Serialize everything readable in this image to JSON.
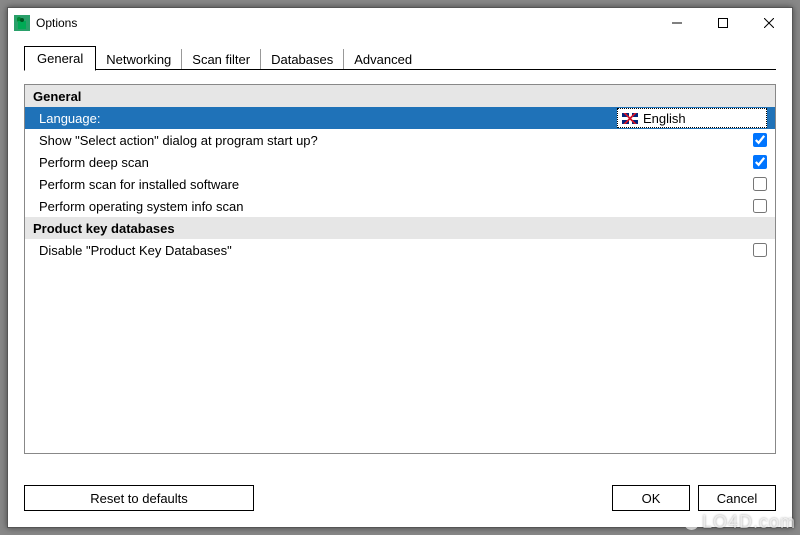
{
  "window": {
    "title": "Options"
  },
  "tabs": [
    {
      "label": "General",
      "active": true
    },
    {
      "label": "Networking",
      "active": false
    },
    {
      "label": "Scan filter",
      "active": false
    },
    {
      "label": "Databases",
      "active": false
    },
    {
      "label": "Advanced",
      "active": false
    }
  ],
  "sections": {
    "general": {
      "heading": "General",
      "rows": {
        "language": {
          "label": "Language:",
          "value": "English"
        },
        "show_dialog": {
          "label": "Show \"Select action\" dialog at program start up?",
          "checked": true
        },
        "deep_scan": {
          "label": "Perform deep scan",
          "checked": true
        },
        "installed_sw": {
          "label": "Perform scan for installed software",
          "checked": false
        },
        "os_info": {
          "label": "Perform operating system info scan",
          "checked": false
        }
      }
    },
    "pkdb": {
      "heading": "Product key databases",
      "rows": {
        "disable": {
          "label": "Disable \"Product Key Databases\"",
          "checked": false
        }
      }
    }
  },
  "buttons": {
    "reset": "Reset to defaults",
    "ok": "OK",
    "cancel": "Cancel"
  },
  "watermark": "LO4D.com"
}
